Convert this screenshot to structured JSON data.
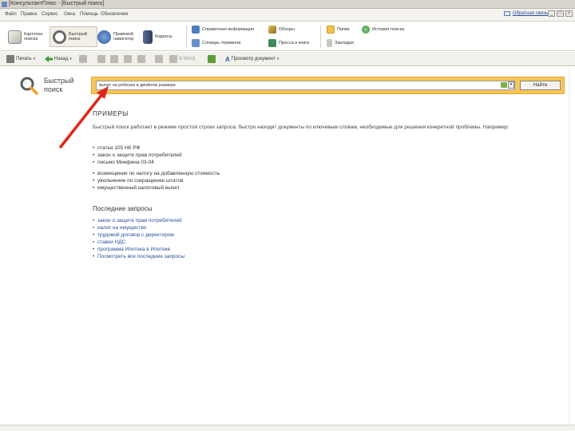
{
  "window": {
    "title": "[КонсультантПлюс - [Быстрый поиск]"
  },
  "menu": {
    "items": [
      "Файл",
      "Правка",
      "Сервис",
      "Окна",
      "Помощь",
      "Обновление"
    ],
    "feedback": "Обратная связь"
  },
  "window_controls": {
    "minimize": "_",
    "maximize": "□",
    "close": "×"
  },
  "ribbon": {
    "card_search": "Карточка поиска",
    "quick_search": "Быстрый поиск",
    "legal_navigator": "Правовой навигатор",
    "codexes": "Кодексы",
    "reference": "Справочная информация",
    "reviews": "Обзоры",
    "dictionary": "Словарь терминов",
    "press": "Пресса и книги",
    "folders": "Папки",
    "history": "История поиска",
    "bookmarks": "Закладки"
  },
  "toolbar": {
    "print": "Печать",
    "back": "Назад",
    "to_word": "В Word",
    "preview": "Просмотр документ"
  },
  "quick_search": {
    "title": "Быстрый поиск",
    "query": "вычет на ребенка в двойном размере",
    "find_button": "Найти"
  },
  "examples": {
    "heading": "ПРИМЕРЫ",
    "intro": "Быстрый поиск работает в режиме простой строки запроса: быстро находит документы по ключевым словам, необходимые для решения конкретной проблемы. Например:",
    "group1": [
      "статья 105 НК РФ",
      "закон о защите прав потребителей",
      "письмо Минфина 03-04"
    ],
    "group2": [
      "возмещение по налогу на добавленную стоимость",
      "увольнение по сокращению штатов",
      "имущественный налоговый вычет"
    ]
  },
  "recent": {
    "heading": "Последние запросы",
    "items": [
      "закон о защите прав потребителей",
      "налог на имущество",
      "трудовой договор с директором",
      "ставки НДС",
      "программа Ипотека в Ипотеке",
      "Посмотреть все последние запросы"
    ]
  }
}
